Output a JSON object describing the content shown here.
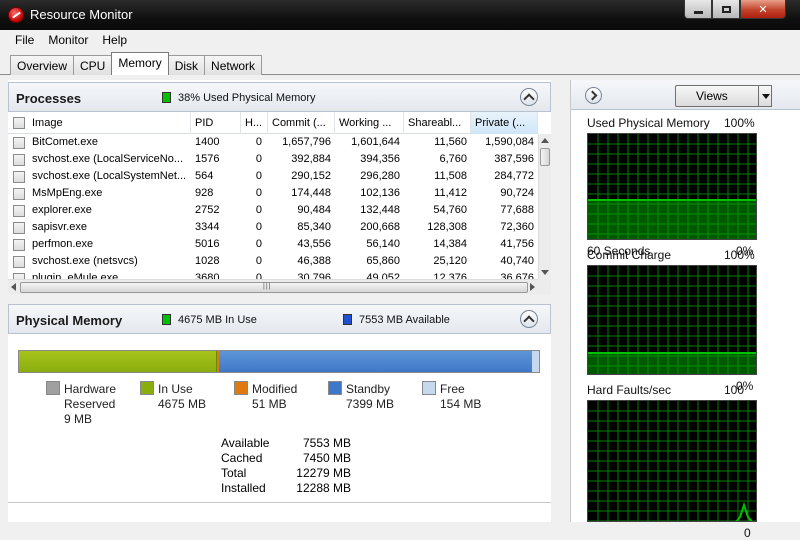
{
  "window": {
    "title": "Resource Monitor"
  },
  "menu": [
    "File",
    "Monitor",
    "Help"
  ],
  "tabs": [
    "Overview",
    "CPU",
    "Memory",
    "Disk",
    "Network"
  ],
  "processes": {
    "title": "Processes",
    "summary": "38% Used Physical Memory",
    "columns": [
      "Image",
      "PID",
      "H...",
      "Commit (...",
      "Working ...",
      "Shareabl...",
      "Private (..."
    ],
    "rows": [
      [
        "BitComet.exe",
        "1400",
        "0",
        "1,657,796",
        "1,601,644",
        "11,560",
        "1,590,084"
      ],
      [
        "svchost.exe (LocalServiceNo...",
        "1576",
        "0",
        "392,884",
        "394,356",
        "6,760",
        "387,596"
      ],
      [
        "svchost.exe (LocalSystemNet...",
        "564",
        "0",
        "290,152",
        "296,280",
        "11,508",
        "284,772"
      ],
      [
        "MsMpEng.exe",
        "928",
        "0",
        "174,448",
        "102,136",
        "11,412",
        "90,724"
      ],
      [
        "explorer.exe",
        "2752",
        "0",
        "90,484",
        "132,448",
        "54,760",
        "77,688"
      ],
      [
        "sapisvr.exe",
        "3344",
        "0",
        "85,340",
        "200,668",
        "128,308",
        "72,360"
      ],
      [
        "perfmon.exe",
        "5016",
        "0",
        "43,556",
        "56,140",
        "14,384",
        "41,756"
      ],
      [
        "svchost.exe (netsvcs)",
        "1028",
        "0",
        "46,388",
        "65,860",
        "25,120",
        "40,740"
      ],
      [
        "plugin_eMule.exe",
        "3680",
        "0",
        "30,796",
        "49,052",
        "12,376",
        "36,676"
      ]
    ]
  },
  "physical_memory": {
    "title": "Physical Memory",
    "in_use_summary": "4675 MB In Use",
    "available_summary": "7553 MB Available",
    "bar_fractions": {
      "hardware_reserved": 0.0007,
      "in_use": 0.3805,
      "modified": 0.0042,
      "standby": 0.6021,
      "free": 0.0125
    },
    "legend": [
      {
        "name": "Hardware Reserved",
        "line1": "Hardware",
        "line2": "Reserved",
        "value": "9 MB",
        "color": "#a0a0a0"
      },
      {
        "name": "In Use",
        "line1": "In Use",
        "line2": "4675 MB",
        "value": "",
        "color": "#8aad0e"
      },
      {
        "name": "Modified",
        "line1": "Modified",
        "line2": "51 MB",
        "value": "",
        "color": "#e07a10"
      },
      {
        "name": "Standby",
        "line1": "Standby",
        "line2": "7399 MB",
        "value": "",
        "color": "#3f78c8"
      },
      {
        "name": "Free",
        "line1": "Free",
        "line2": "154 MB",
        "value": "",
        "color": "#c6d8ee"
      }
    ],
    "stats": [
      {
        "label": "Available",
        "value": "7553 MB"
      },
      {
        "label": "Cached",
        "value": "7450 MB"
      },
      {
        "label": "Total",
        "value": "12279 MB"
      },
      {
        "label": "Installed",
        "value": "12288 MB"
      }
    ]
  },
  "side": {
    "views_label": "Views",
    "graphs": [
      {
        "title": "Used Physical Memory",
        "max": "100%",
        "footer_left": "60 Seconds",
        "footer_right": "0%",
        "level": 0.38
      },
      {
        "title": "Commit Charge",
        "max": "100%",
        "footer_left": "",
        "footer_right": "0%",
        "level": 0.21
      },
      {
        "title": "Hard Faults/sec",
        "max": "100",
        "footer_left": "",
        "footer_right": "0",
        "level": 0.02
      }
    ]
  },
  "colors": {
    "graph_line": "#00c000",
    "graph_grid": "#008000",
    "graph_bg": "#000000"
  }
}
